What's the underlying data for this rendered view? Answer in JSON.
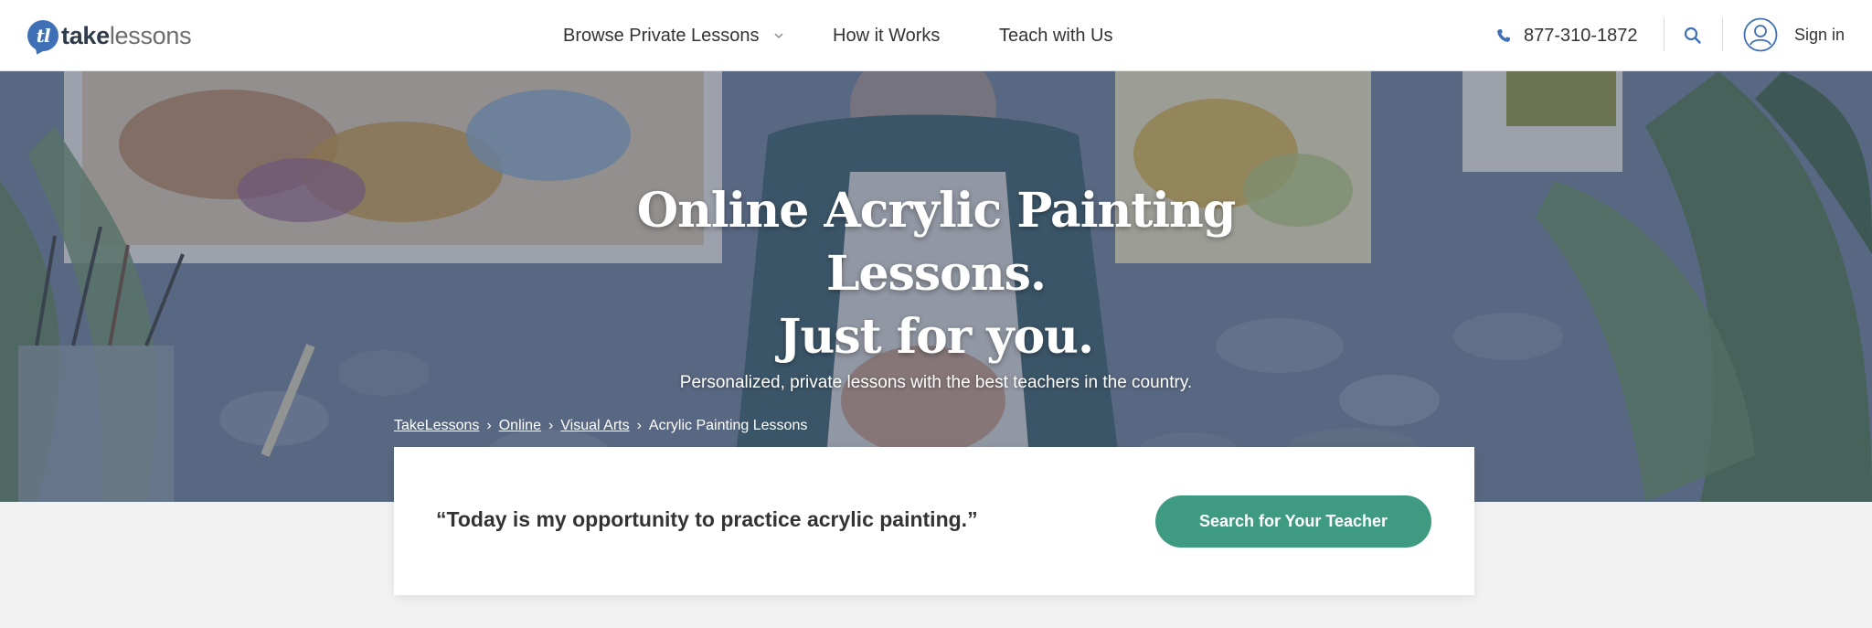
{
  "brand": {
    "logo_mark": "tl",
    "name_bold": "take",
    "name_light": "lessons"
  },
  "nav": {
    "browse": "Browse Private Lessons",
    "how": "How it Works",
    "teach": "Teach with Us"
  },
  "contact": {
    "phone": "877-310-1872"
  },
  "account": {
    "signin": "Sign in"
  },
  "hero": {
    "title_line1": "Online Acrylic Painting",
    "title_line2": "Lessons.",
    "title_line3": "Just for you.",
    "subtitle": "Personalized, private lessons with the best teachers in the country."
  },
  "breadcrumb": {
    "items": [
      "TakeLessons",
      "Online",
      "Visual Arts"
    ],
    "current": "Acrylic Painting Lessons",
    "separator": "›"
  },
  "card": {
    "quote": "“Today is my opportunity to practice acrylic painting.”",
    "cta": "Search for Your Teacher"
  },
  "colors": {
    "brand_blue": "#3f6fb5",
    "cta_green": "#3f9a82",
    "hero_overlay": "#3a5078"
  },
  "icons": [
    "phone-icon",
    "search-icon",
    "user-avatar-icon",
    "chevron-down-icon"
  ]
}
